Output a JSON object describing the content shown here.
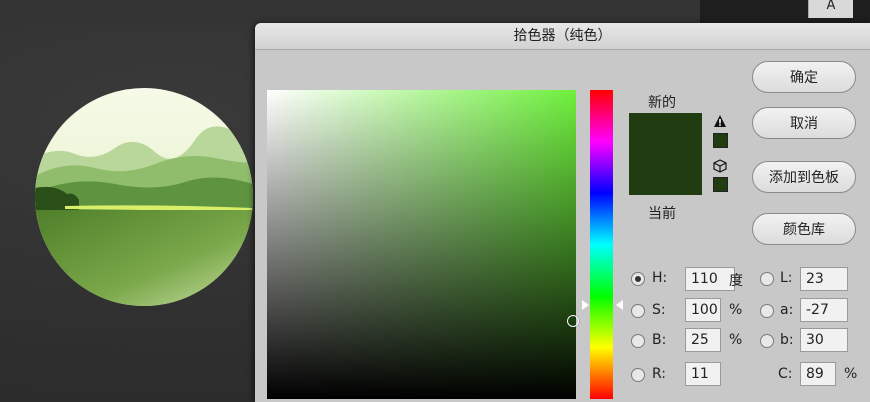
{
  "dialog": {
    "title": "拾色器（纯色）",
    "new_label": "新的",
    "current_label": "当前",
    "buttons": {
      "ok": "确定",
      "cancel": "取消",
      "add_swatch": "添加到色板",
      "color_library": "颜色库"
    },
    "fields": {
      "H": {
        "label": "H:",
        "value": "110",
        "unit": "度"
      },
      "S": {
        "label": "S:",
        "value": "100",
        "unit": "%"
      },
      "B": {
        "label": "B:",
        "value": "25",
        "unit": "%"
      },
      "R": {
        "label": "R:",
        "value": "11"
      },
      "L": {
        "label": "L:",
        "value": "23"
      },
      "a": {
        "label": "a:",
        "value": "-27"
      },
      "b": {
        "label": "b:",
        "value": "30"
      },
      "C": {
        "label": "C:",
        "value": "89",
        "unit": "%"
      }
    },
    "colors": {
      "new": "#1f3d10",
      "current": "#1f3d10",
      "hue_base": "#6ef03c"
    }
  },
  "corner_button": "A"
}
